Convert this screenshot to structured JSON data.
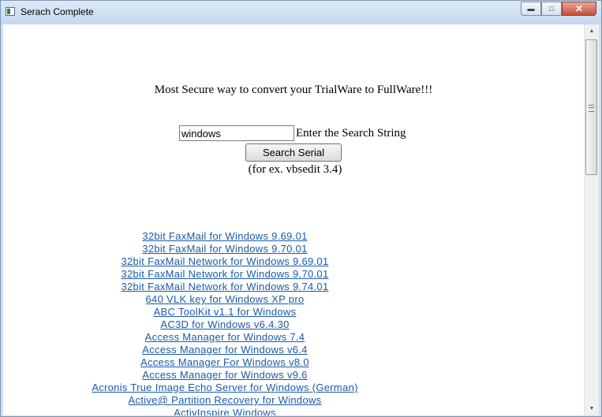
{
  "window": {
    "title": "Serach Complete"
  },
  "page": {
    "headline": "Most Secure way to convert your TrialWare to FullWare!!!",
    "search": {
      "value": "windows",
      "label": "Enter the Search String",
      "button_label": "Search Serial",
      "example": "(for ex. vbsedit 3.4)"
    },
    "results": [
      "32bit FaxMail for Windows 9.69.01",
      "32bit FaxMail for Windows 9.70.01",
      "32bit FaxMail Network for Windows 9.69.01",
      "32bit FaxMail Network for Windows 9.70.01",
      "32bit FaxMail Network for Windows 9.74.01",
      "640 VLK key for Windows XP pro",
      "ABC ToolKit v1.1 for Windows",
      "AC3D for Windows v6.4.30",
      "Access Manager for Windows 7.4",
      "Access Manager for Windows v6.4",
      "Access Manager For Windows v8.0",
      "Access Manager for Windows v9.6",
      "Acronis True Image Echo Server for Windows (German)",
      "Active@ Partition Recovery for Windows",
      "ActivInspire Windows"
    ]
  },
  "colors": {
    "link": "#1a5aa8",
    "titlebar": "#cfe0f0",
    "close_button": "#c7503b"
  }
}
